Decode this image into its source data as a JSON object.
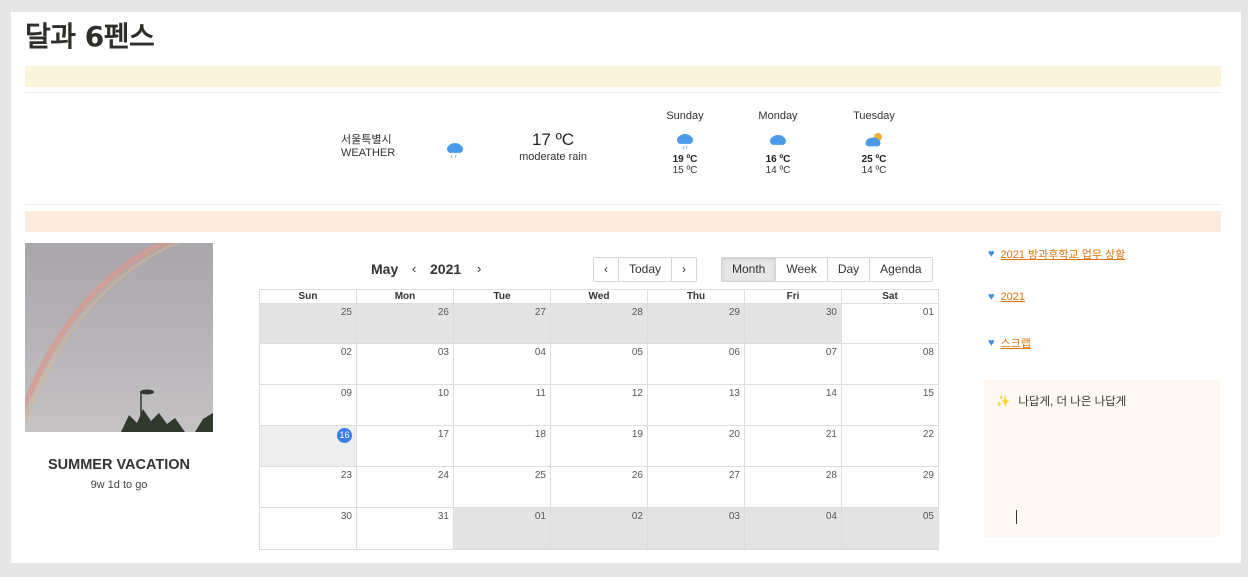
{
  "page": {
    "title": "달과 6펜스"
  },
  "weather": {
    "city": "서울특별시",
    "city_sub": "WEATHER",
    "current": {
      "temp": "17 ºC",
      "desc": "moderate rain",
      "icon": "rain-cloud-icon"
    },
    "forecast": [
      {
        "day": "Sunday",
        "hi": "19 ºC",
        "lo": "15 ºC",
        "icon": "rain-cloud-icon"
      },
      {
        "day": "Monday",
        "hi": "16 ºC",
        "lo": "14 ºC",
        "icon": "cloud-icon"
      },
      {
        "day": "Tuesday",
        "hi": "25 ºC",
        "lo": "14 ºC",
        "icon": "partly-cloudy-icon"
      }
    ]
  },
  "countdown": {
    "title": "SUMMER VACATION",
    "remaining": "9w 1d to go"
  },
  "calendar": {
    "month": "May",
    "year": "2021",
    "prev_arrow": "‹",
    "next_arrow": "›",
    "nav": {
      "prev": "‹",
      "today": "Today",
      "next": "›"
    },
    "views": [
      {
        "label": "Month",
        "active": true
      },
      {
        "label": "Week",
        "active": false
      },
      {
        "label": "Day",
        "active": false
      },
      {
        "label": "Agenda",
        "active": false
      }
    ],
    "weekdays": [
      "Sun",
      "Mon",
      "Tue",
      "Wed",
      "Thu",
      "Fri",
      "Sat"
    ],
    "today": "16",
    "weeks": [
      [
        {
          "d": "25",
          "off": true
        },
        {
          "d": "26",
          "off": true
        },
        {
          "d": "27",
          "off": true
        },
        {
          "d": "28",
          "off": true
        },
        {
          "d": "29",
          "off": true
        },
        {
          "d": "30",
          "off": true
        },
        {
          "d": "01",
          "off": false
        }
      ],
      [
        {
          "d": "02",
          "off": false
        },
        {
          "d": "03",
          "off": false
        },
        {
          "d": "04",
          "off": false
        },
        {
          "d": "05",
          "off": false
        },
        {
          "d": "06",
          "off": false
        },
        {
          "d": "07",
          "off": false
        },
        {
          "d": "08",
          "off": false
        }
      ],
      [
        {
          "d": "09",
          "off": false
        },
        {
          "d": "10",
          "off": false
        },
        {
          "d": "11",
          "off": false
        },
        {
          "d": "12",
          "off": false
        },
        {
          "d": "13",
          "off": false
        },
        {
          "d": "14",
          "off": false
        },
        {
          "d": "15",
          "off": false
        }
      ],
      [
        {
          "d": "16",
          "off": false
        },
        {
          "d": "17",
          "off": false
        },
        {
          "d": "18",
          "off": false
        },
        {
          "d": "19",
          "off": false
        },
        {
          "d": "20",
          "off": false
        },
        {
          "d": "21",
          "off": false
        },
        {
          "d": "22",
          "off": false
        }
      ],
      [
        {
          "d": "23",
          "off": false
        },
        {
          "d": "24",
          "off": false
        },
        {
          "d": "25",
          "off": false
        },
        {
          "d": "26",
          "off": false
        },
        {
          "d": "27",
          "off": false
        },
        {
          "d": "28",
          "off": false
        },
        {
          "d": "29",
          "off": false
        }
      ],
      [
        {
          "d": "30",
          "off": false
        },
        {
          "d": "31",
          "off": false
        },
        {
          "d": "01",
          "off": true
        },
        {
          "d": "02",
          "off": true
        },
        {
          "d": "03",
          "off": true
        },
        {
          "d": "04",
          "off": true
        },
        {
          "d": "05",
          "off": true
        }
      ]
    ]
  },
  "links": [
    {
      "icon": "blue-heart-icon",
      "label": "2021 방과후학교 업무 상황"
    },
    {
      "icon": "blue-heart-icon",
      "label": "2021"
    },
    {
      "icon": "blue-heart-icon",
      "label": "스크랩"
    }
  ],
  "note": {
    "icon": "sparkles-icon",
    "text": "나답게, 더 나은 나답게"
  },
  "colors": {
    "band_yellow": "#fbf3db",
    "band_peach": "#fbecdd",
    "link": "#d9730d",
    "heart": "#3f8fe0",
    "today_badge": "#3b7de9"
  }
}
